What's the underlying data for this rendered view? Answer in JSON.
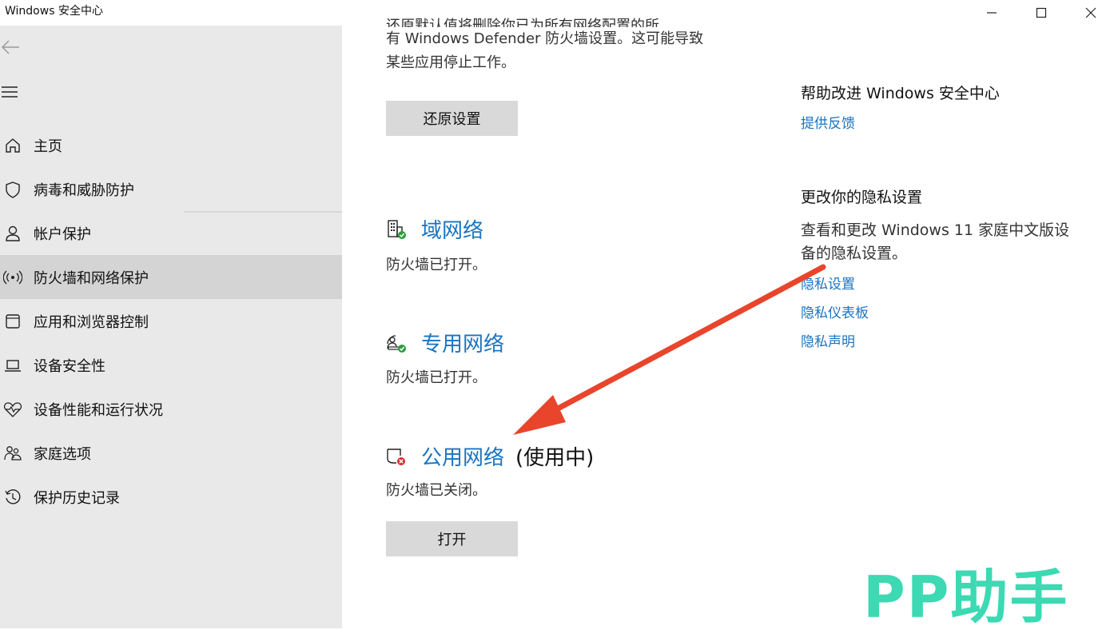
{
  "window": {
    "title": "Windows 安全中心"
  },
  "sidebar": {
    "items": [
      {
        "label": "主页",
        "icon": "home-icon"
      },
      {
        "label": "病毒和威胁防护",
        "icon": "shield-icon"
      },
      {
        "label": "帐户保护",
        "icon": "person-icon"
      },
      {
        "label": "防火墙和网络保护",
        "icon": "wifi-antenna-icon",
        "selected": true
      },
      {
        "label": "应用和浏览器控制",
        "icon": "app-window-icon"
      },
      {
        "label": "设备安全性",
        "icon": "laptop-icon"
      },
      {
        "label": "设备性能和运行状况",
        "icon": "heart-pulse-icon"
      },
      {
        "label": "家庭选项",
        "icon": "family-icon"
      },
      {
        "label": "保护历史记录",
        "icon": "history-icon"
      }
    ]
  },
  "main": {
    "intro_lines": [
      "还原默认值将删除你已为所有网络配置的所",
      "有 Windows Defender 防火墙设置。这可能导致",
      "某些应用停止工作。"
    ],
    "restore_button": "还原设置",
    "networks": [
      {
        "name": "域网络",
        "status": "防火墙已打开。",
        "icon": "domain-network-icon"
      },
      {
        "name": "专用网络",
        "status": "防火墙已打开。",
        "icon": "private-network-icon"
      },
      {
        "name": "公用网络",
        "suffix": "(使用中)",
        "status": "防火墙已关闭。",
        "icon": "public-network-icon"
      }
    ],
    "turn_on_button": "打开"
  },
  "right": {
    "feedback_heading": "帮助改进 Windows 安全中心",
    "feedback_link": "提供反馈",
    "privacy_heading": "更改你的隐私设置",
    "privacy_text": "查看和更改 Windows 11 家庭中文版设备的隐私设置。",
    "privacy_links": [
      "隐私设置",
      "隐私仪表板",
      "隐私声明"
    ]
  },
  "watermark": "PP助手",
  "colors": {
    "link": "#1a74c0",
    "sidebar_bg": "#e9e9e9",
    "selected_bg": "#d4d4d4",
    "button_bg": "#d9d9d9",
    "arrow": "#e8452c",
    "watermark": "#3dd9b3"
  }
}
